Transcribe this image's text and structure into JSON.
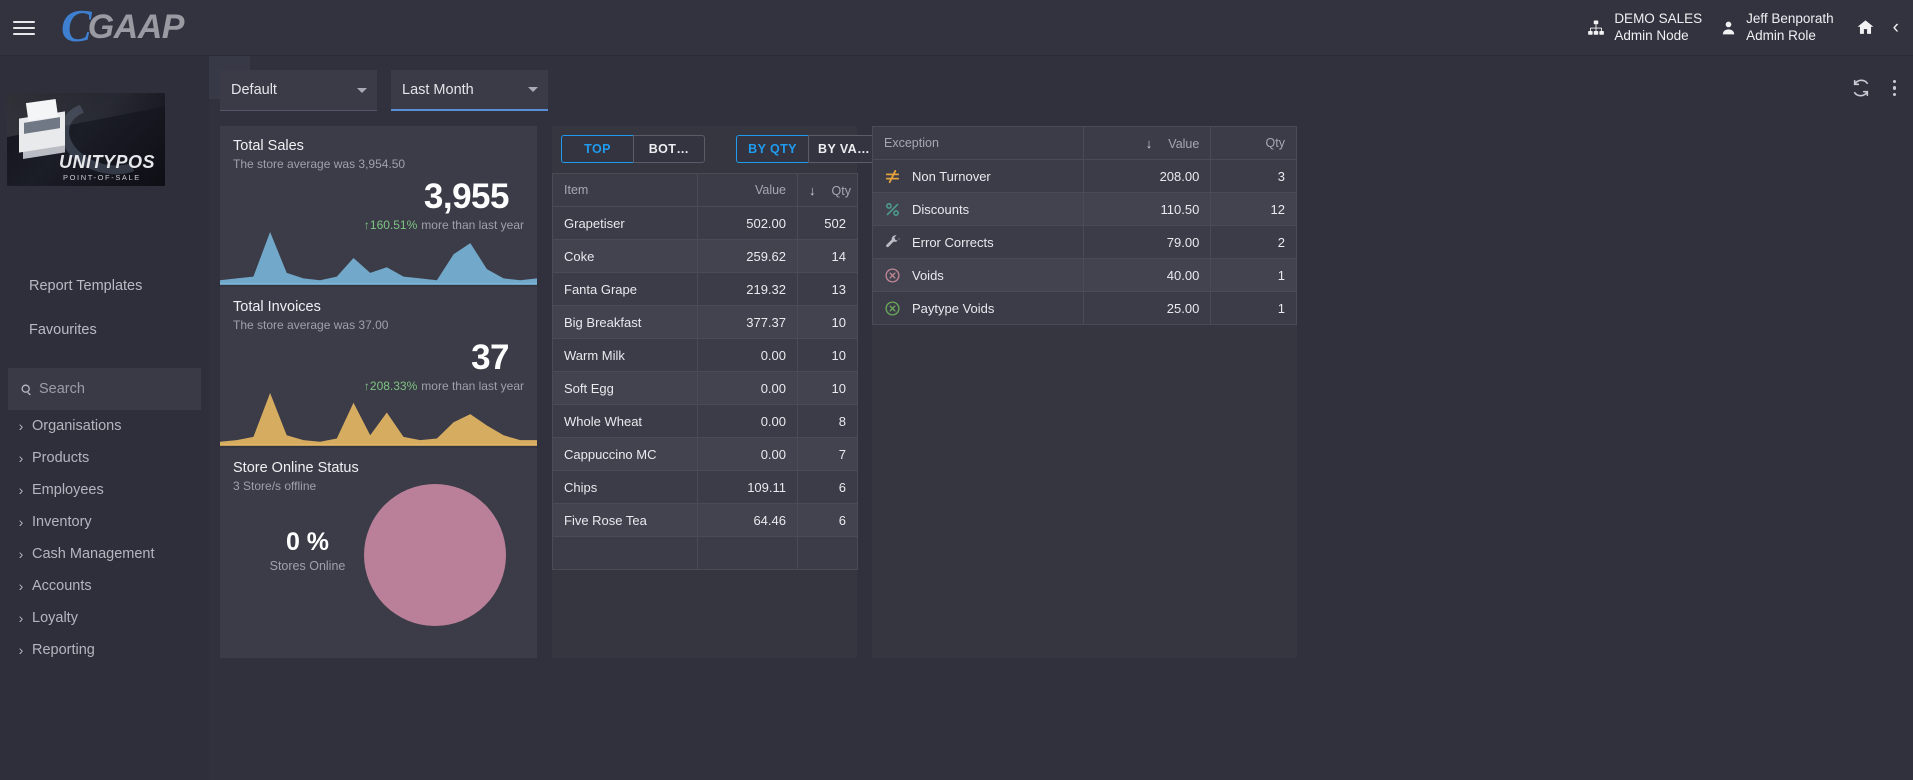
{
  "header": {
    "logo_c": "C",
    "logo_text": "GAAP",
    "menu_icon": "hamburger-icon",
    "node": {
      "line1": "DEMO SALES",
      "line2": "Admin Node",
      "icon": "org-tree-icon"
    },
    "user": {
      "line1": "Jeff Benporath",
      "line2": "Admin Role",
      "icon": "person-icon"
    },
    "home_icon": "home-icon",
    "collapse_icon": "chevron-left-icon"
  },
  "sidebar": {
    "thumbnail": {
      "brand": "UNITYPOS",
      "subtitle": "POINT-OF-SALE"
    },
    "links": [
      {
        "label": "Report Templates",
        "name": "report-templates"
      },
      {
        "label": "Favourites",
        "name": "favourites"
      }
    ],
    "search": {
      "placeholder": "Search",
      "value": "",
      "icon": "search-icon"
    },
    "nav": [
      {
        "label": "Organisations"
      },
      {
        "label": "Products"
      },
      {
        "label": "Employees"
      },
      {
        "label": "Inventory"
      },
      {
        "label": "Cash Management"
      },
      {
        "label": "Accounts"
      },
      {
        "label": "Loyalty"
      },
      {
        "label": "Reporting"
      }
    ]
  },
  "toolbar": {
    "pin_icon": "pin-icon",
    "filters": [
      {
        "name": "profile-select",
        "value": "Default"
      },
      {
        "name": "period-select",
        "value": "Last Month"
      }
    ],
    "refresh_icon": "refresh-icon",
    "menu_icon": "kebab-menu-icon"
  },
  "kpis": {
    "total_sales": {
      "title": "Total Sales",
      "subtitle": "The store average was 3,954.50",
      "value": "3,955",
      "delta_pct": "160.51%",
      "delta_arrow": "↑",
      "delta_text": "more than last year",
      "color": "#7dbbe0"
    },
    "total_invoices": {
      "title": "Total Invoices",
      "subtitle": "The store average was 37.00",
      "value": "37",
      "delta_pct": "208.33%",
      "delta_arrow": "↑",
      "delta_text": "more than last year",
      "color": "#e8b864"
    },
    "store_online": {
      "title": "Store Online Status",
      "subtitle": "3 Store/s offline",
      "value": "0 %",
      "label": "Stores Online",
      "donut_color": "#bb8099",
      "donut_pct": 0
    }
  },
  "items_panel": {
    "tabs_rank": [
      {
        "label": "TOP",
        "selected": true
      },
      {
        "label": "BOT…",
        "selected": false
      }
    ],
    "tabs_measure": [
      {
        "label": "BY QTY",
        "selected": true
      },
      {
        "label": "BY VA…",
        "selected": false
      }
    ],
    "columns": [
      "Item",
      "Value",
      "Qty"
    ],
    "sort_column": "Qty",
    "sort_dir": "↓",
    "rows": [
      {
        "item": "Grapetiser",
        "value": "502.00",
        "qty": "502"
      },
      {
        "item": "Coke",
        "value": "259.62",
        "qty": "14"
      },
      {
        "item": "Fanta Grape",
        "value": "219.32",
        "qty": "13"
      },
      {
        "item": "Big Breakfast",
        "value": "377.37",
        "qty": "10"
      },
      {
        "item": "Warm Milk",
        "value": "0.00",
        "qty": "10"
      },
      {
        "item": "Soft Egg",
        "value": "0.00",
        "qty": "10"
      },
      {
        "item": "Whole Wheat",
        "value": "0.00",
        "qty": "8"
      },
      {
        "item": "Cappuccino MC",
        "value": "0.00",
        "qty": "7"
      },
      {
        "item": "Chips",
        "value": "109.11",
        "qty": "6"
      },
      {
        "item": "Five Rose Tea",
        "value": "64.46",
        "qty": "6"
      }
    ]
  },
  "exceptions_panel": {
    "columns": [
      "Exception",
      "Value",
      "Qty"
    ],
    "sort_column": "Value",
    "sort_dir": "↓",
    "rows": [
      {
        "label": "Non Turnover",
        "icon": "not-equal-icon",
        "icon_color": "#e2a13c",
        "value": "208.00",
        "qty": "3"
      },
      {
        "label": "Discounts",
        "icon": "percent-icon",
        "icon_color": "#4e9c8f",
        "value": "110.50",
        "qty": "12"
      },
      {
        "label": "Error Corrects",
        "icon": "wrench-icon",
        "icon_color": "#b9bcc4",
        "value": "79.00",
        "qty": "2"
      },
      {
        "label": "Voids",
        "icon": "circle-x-icon",
        "icon_color": "#c08694",
        "value": "40.00",
        "qty": "1"
      },
      {
        "label": "Paytype Voids",
        "icon": "circle-x-icon",
        "icon_color": "#6aa85c",
        "value": "25.00",
        "qty": "1"
      }
    ]
  },
  "chart_data": [
    {
      "type": "area",
      "title": "Total Sales",
      "series": [
        {
          "name": "Total Sales",
          "values": [
            2,
            3,
            4,
            28,
            6,
            3,
            2,
            4,
            14,
            6,
            9,
            4,
            3,
            2,
            16,
            22,
            8,
            3,
            2,
            3
          ]
        }
      ],
      "color": "#7dbbe0",
      "grid": false,
      "legend": "none"
    },
    {
      "type": "area",
      "title": "Total Invoices",
      "series": [
        {
          "name": "Total Invoices",
          "values": [
            2,
            3,
            5,
            32,
            6,
            3,
            2,
            4,
            26,
            6,
            20,
            5,
            3,
            4,
            14,
            19,
            12,
            6,
            3,
            3
          ]
        }
      ],
      "color": "#e8b864",
      "grid": false,
      "legend": "none"
    },
    {
      "type": "pie",
      "title": "Store Online Status",
      "labels": [
        "Stores Offline"
      ],
      "values": [
        100
      ],
      "colors": [
        "#bb8099"
      ],
      "legend": "none"
    }
  ]
}
